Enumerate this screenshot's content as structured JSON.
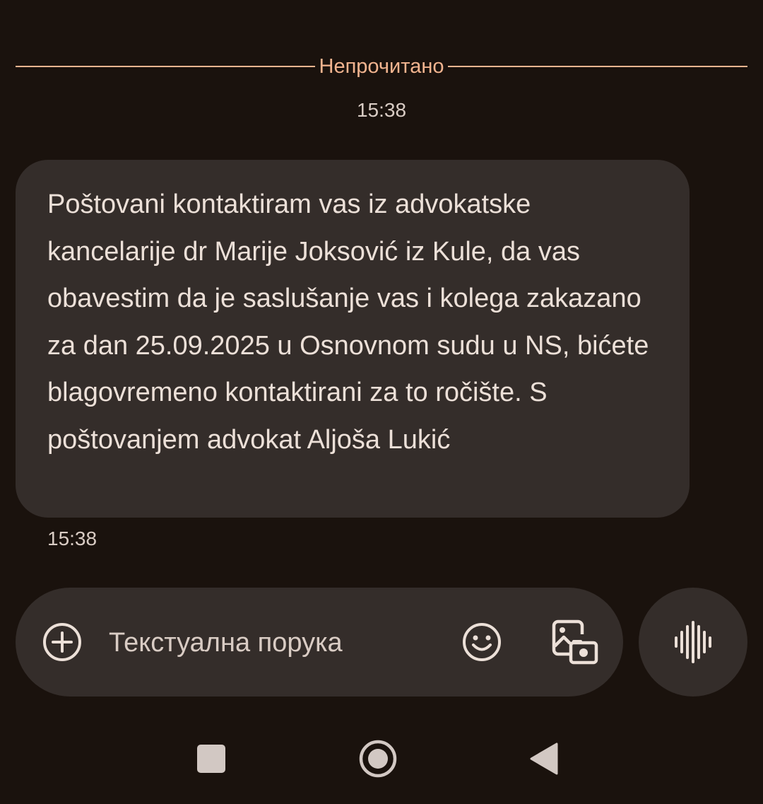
{
  "conversation": {
    "unread_divider_label": "Непрочитано",
    "header_timestamp": "15:38",
    "messages": [
      {
        "text": "Poštovani kontaktiram vas iz advokatske kancelarije dr Marije Joksović iz Kule, da vas obavestim da je saslušanje vas i kolega zakazano za dan 25.09.2025 u Osnovnom sudu u NS, bićete blagovremeno kontaktirani za to ročište. S poštovanjem advokat Aljoša Lukić",
        "timestamp": "15:38"
      }
    ]
  },
  "composer": {
    "placeholder": "Текстуална порука",
    "value": "",
    "icons": {
      "add": "add-circle-icon",
      "emoji": "emoji-icon",
      "media": "gallery-icon",
      "voice": "voice-waveform-icon"
    }
  },
  "navigation": {
    "icons": [
      "recents-square-icon",
      "home-circle-icon",
      "back-triangle-icon"
    ]
  },
  "colors": {
    "background": "#1a120d",
    "accent": "#f2b48f",
    "bubble": "#342d2a",
    "text": "#ece0d8"
  }
}
